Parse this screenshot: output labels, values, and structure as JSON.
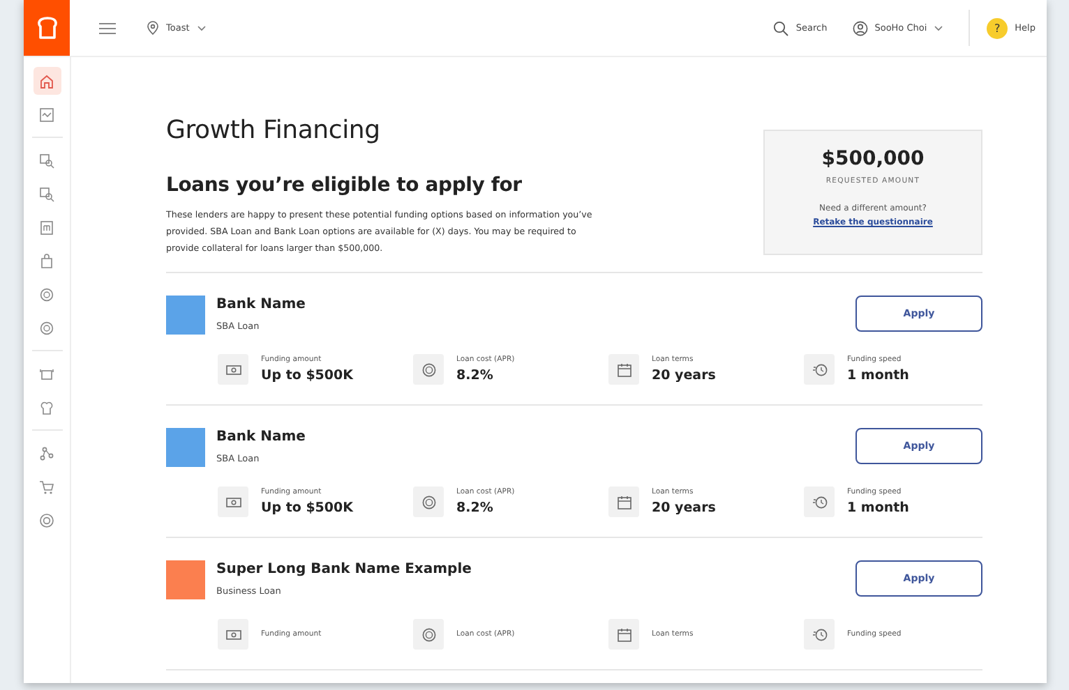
{
  "top_bar": {
    "location": "Toast",
    "search_label": "Search",
    "user_name": "SooHo Choi",
    "help_badge": "?",
    "help_label": "Help"
  },
  "sidebar": {
    "groups": [
      {
        "items": [
          {
            "selected": true
          },
          {
            "selected": false
          }
        ]
      },
      {
        "items": [
          {
            "selected": false
          },
          {
            "selected": false
          },
          {
            "selected": false
          },
          {
            "selected": false
          },
          {
            "selected": false
          },
          {
            "selected": false
          }
        ]
      },
      {
        "items": [
          {
            "selected": false
          },
          {
            "selected": false
          }
        ]
      },
      {
        "items": [
          {
            "selected": false
          },
          {
            "selected": false
          },
          {
            "selected": false
          }
        ]
      }
    ]
  },
  "page_title": "Growth Financing",
  "section_title": "Loans you’re eligible to apply for",
  "intro": "These lenders are happy to present these potential funding options based on information you’ve provided. SBA Loan and Bank Loan options are available for (X) days. You may be required to provide collateral for loans larger than $500,000.",
  "summary": {
    "amount": "$500,000",
    "amount_label": "REQUESTED AMOUNT",
    "prompt": "Need a different amount?",
    "link": "Retake the questionnaire"
  },
  "loans": [
    {
      "bank": "Bank Name",
      "type": "SBA Loan",
      "color": "#5ba3e8",
      "button": "Apply",
      "metrics": [
        {
          "label": "Funding amount",
          "value": "Up to $500K"
        },
        {
          "label": "Loan cost (APR)",
          "value": "8.2%"
        },
        {
          "label": "Loan terms",
          "value": "20 years"
        },
        {
          "label": "Funding speed",
          "value": "1 month"
        }
      ]
    },
    {
      "bank": "Bank Name",
      "type": "SBA Loan",
      "color": "#5ba3e8",
      "button": "Apply",
      "metrics": [
        {
          "label": "Funding amount",
          "value": "Up to $500K"
        },
        {
          "label": "Loan cost (APR)",
          "value": "8.2%"
        },
        {
          "label": "Loan terms",
          "value": "20 years"
        },
        {
          "label": "Funding speed",
          "value": "1 month"
        }
      ]
    },
    {
      "bank": "Super Long Bank Name Example",
      "type": "Business Loan",
      "color": "#fb7f4f",
      "button": "Apply",
      "metrics": [
        {
          "label": "Funding amount"
        },
        {
          "label": "Loan cost (APR)"
        },
        {
          "label": "Loan terms"
        },
        {
          "label": "Funding speed"
        }
      ]
    }
  ]
}
